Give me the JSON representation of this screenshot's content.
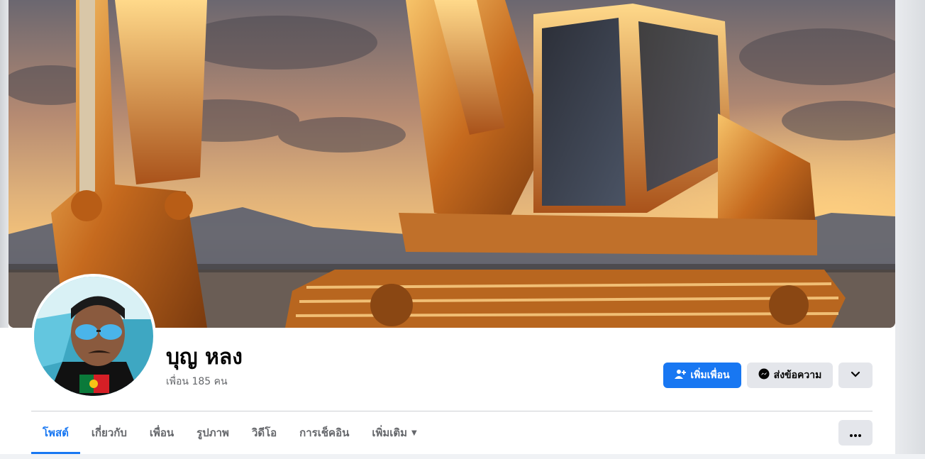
{
  "profile": {
    "name": "บุญ หลง",
    "friends_count": "เพื่อน 185 คน"
  },
  "actions": {
    "add_friend_label": "เพิ่มเพื่อน",
    "message_label": "ส่งข้อความ"
  },
  "tabs": [
    {
      "label": "โพสต์",
      "active": true
    },
    {
      "label": "เกี่ยวกับ"
    },
    {
      "label": "เพื่อน"
    },
    {
      "label": "รูปภาพ"
    },
    {
      "label": "วิดีโอ"
    },
    {
      "label": "การเช็คอิน"
    },
    {
      "label": "เพิ่มเติม"
    }
  ],
  "colors": {
    "accent": "#1877f2",
    "secondary_button": "#e4e6eb",
    "text_primary": "#050505",
    "text_secondary": "#65676b"
  },
  "icons": {
    "add_friend": "person-plus-icon",
    "message": "messenger-icon",
    "dropdown": "chevron-down-icon",
    "more": "ellipsis-icon",
    "tab_more": "caret-down-icon"
  }
}
